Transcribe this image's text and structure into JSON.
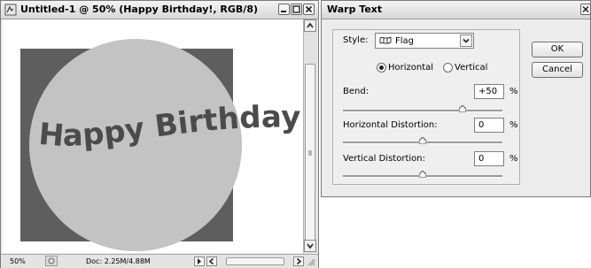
{
  "document": {
    "title": "Untitled-1 @ 50% (Happy Birthday!, RGB/8)",
    "canvas_text": "Happy Birthday!",
    "colors": {
      "background": "#5e5e5e",
      "circle": "#c3c3c3",
      "text": "#4b4b4b"
    },
    "status": {
      "zoom": "50%",
      "doc_size": "Doc: 2.25M/4.88M"
    }
  },
  "dialog": {
    "title": "Warp Text",
    "style_label": "Style:",
    "style_value": "Flag",
    "orientation": {
      "horizontal_label": "Horizontal",
      "vertical_label": "Vertical",
      "selected": "Horizontal"
    },
    "bend": {
      "label": "Bend:",
      "value": "+50",
      "unit": "%",
      "level": 50
    },
    "horizontal_distortion": {
      "label": "Horizontal Distortion:",
      "value": "0",
      "unit": "%",
      "level": 0
    },
    "vertical_distortion": {
      "label": "Vertical Distortion:",
      "value": "0",
      "unit": "%",
      "level": 0
    },
    "ok_label": "OK",
    "cancel_label": "Cancel"
  }
}
